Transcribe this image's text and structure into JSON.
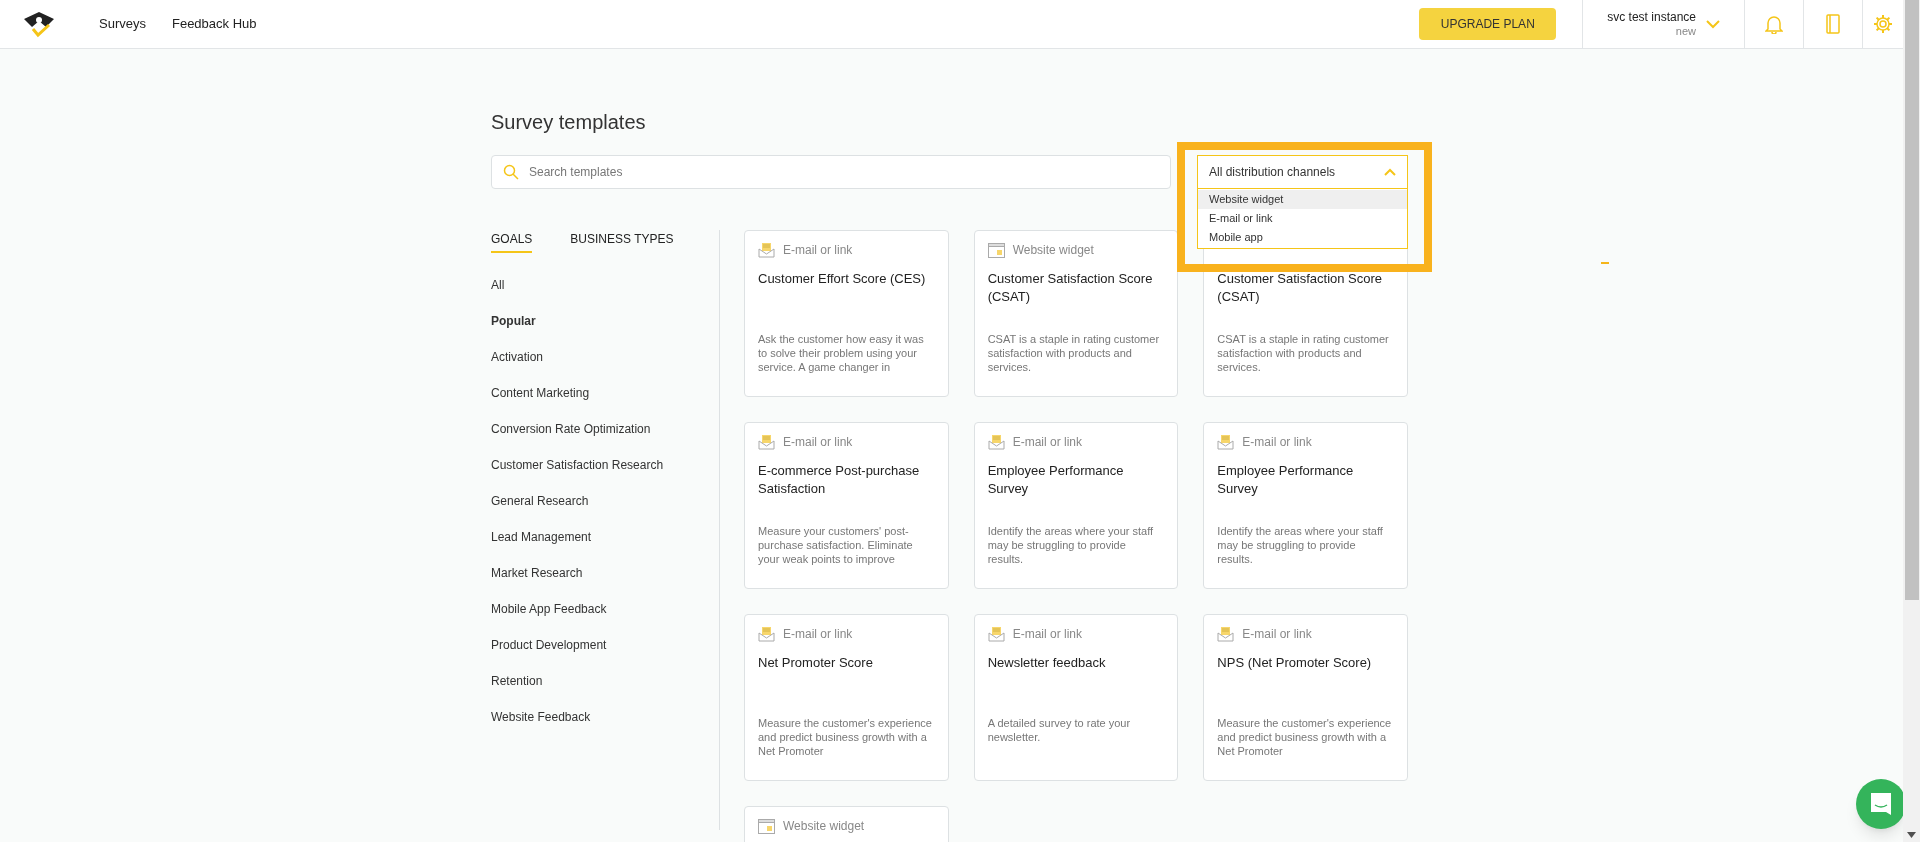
{
  "header": {
    "nav": [
      {
        "label": "Surveys"
      },
      {
        "label": "Feedback Hub"
      }
    ],
    "upgrade_button": "UPGRADE PLAN",
    "account": {
      "name": "svc test instance",
      "status": "new"
    }
  },
  "title": "Survey templates",
  "search": {
    "placeholder": "Search templates"
  },
  "channel_filter": {
    "value": "All distribution channels",
    "expanded": true,
    "highlighted": true,
    "options": [
      {
        "label": "Website widget",
        "selected": true
      },
      {
        "label": "E-mail or link",
        "selected": false
      },
      {
        "label": "Mobile app",
        "selected": false
      }
    ]
  },
  "tabs": [
    {
      "label": "GOALS",
      "selected": true
    },
    {
      "label": "BUSINESS TYPES",
      "selected": false
    }
  ],
  "categories": [
    {
      "label": "All",
      "selected": false
    },
    {
      "label": "Popular",
      "selected": true
    },
    {
      "label": "Activation",
      "selected": false
    },
    {
      "label": "Content Marketing",
      "selected": false
    },
    {
      "label": "Conversion Rate Optimization",
      "selected": false
    },
    {
      "label": "Customer Satisfaction Research",
      "selected": false
    },
    {
      "label": "General Research",
      "selected": false
    },
    {
      "label": "Lead Management",
      "selected": false
    },
    {
      "label": "Market Research",
      "selected": false
    },
    {
      "label": "Mobile App Feedback",
      "selected": false
    },
    {
      "label": "Product Development",
      "selected": false
    },
    {
      "label": "Retention",
      "selected": false
    },
    {
      "label": "Website Feedback",
      "selected": false
    }
  ],
  "templates": [
    {
      "kind": "email",
      "channel": "E-mail or link",
      "title": "Customer Effort Score (CES)",
      "description": "Ask the customer how easy it was to solve their problem using your service. A game changer in"
    },
    {
      "kind": "widget",
      "channel": "Website widget",
      "title": "Customer Satisfaction Score (CSAT)",
      "description": "CSAT is a staple in rating customer satisfaction with products and services."
    },
    {
      "title": "Customer Satisfaction Score (CSAT)",
      "description": "CSAT is a staple in rating customer satisfaction with products and services."
    },
    {
      "kind": "email",
      "channel": "E-mail or link",
      "title": "E-commerce Post-purchase Satisfaction",
      "description": "Measure your customers' post-purchase satisfaction. Eliminate your weak points to improve"
    },
    {
      "kind": "email",
      "channel": "E-mail or link",
      "title": "Employee Performance Survey",
      "description": "Identify the areas where your staff may be struggling to provide results."
    },
    {
      "kind": "email",
      "channel": "E-mail or link",
      "title": "Employee Performance Survey",
      "description": "Identify the areas where your staff may be struggling to provide results."
    },
    {
      "kind": "email",
      "channel": "E-mail or link",
      "title": "Net Promoter Score",
      "description": "Measure the customer's experience and predict business growth with a Net Promoter"
    },
    {
      "kind": "email",
      "channel": "E-mail or link",
      "title": "Newsletter feedback",
      "description": "A detailed survey to rate your newsletter."
    },
    {
      "kind": "email",
      "channel": "E-mail or link",
      "title": "NPS (Net Promoter Score)",
      "description": "Measure the customer's experience and predict business growth with a Net Promoter"
    },
    {
      "kind": "widget",
      "channel": "Website widget"
    }
  ]
}
